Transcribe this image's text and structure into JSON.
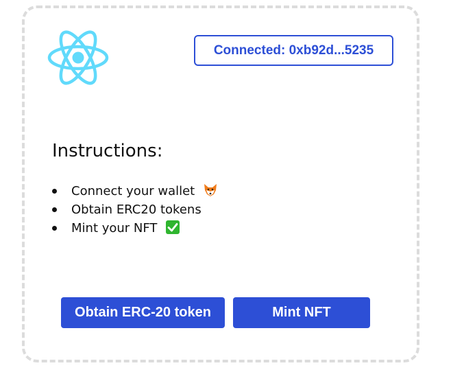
{
  "header": {
    "logo_icon": "react-atom-icon",
    "logo_color": "#61dafb",
    "connected_label": "Connected: 0xb92d...5235"
  },
  "instructions": {
    "title": "Instructions:",
    "steps": [
      {
        "text": "Connect your wallet",
        "icon": "fox-icon"
      },
      {
        "text": "Obtain ERC20 tokens",
        "icon": ""
      },
      {
        "text": "Mint your NFT",
        "icon": "check-mark-icon"
      }
    ]
  },
  "actions": {
    "obtain_label": "Obtain ERC-20 token",
    "mint_label": "Mint NFT"
  },
  "colors": {
    "accent": "#2d4fd6",
    "card_border": "#dcdcdc",
    "check_green": "#2fb52f",
    "fox_orange": "#f07c1b"
  }
}
